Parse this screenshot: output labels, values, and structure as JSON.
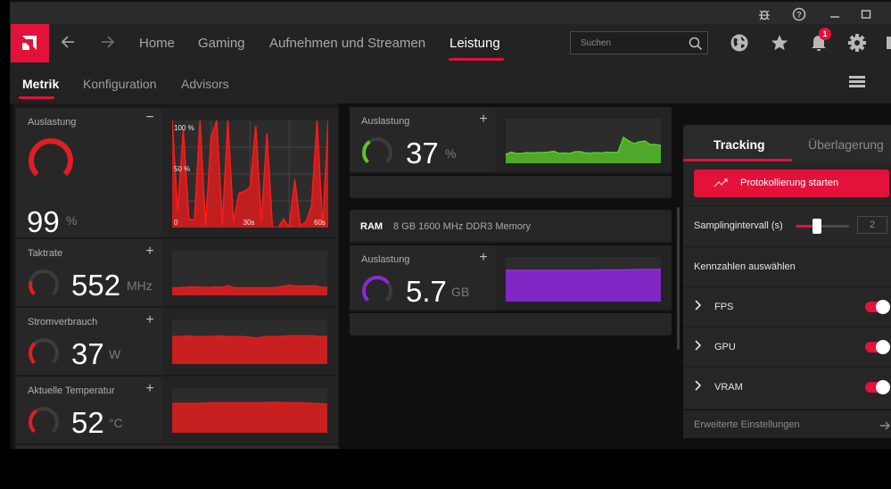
{
  "titlebar": {
    "icons": [
      "bug-report-icon",
      "help-icon",
      "minimize-icon",
      "maximize-icon"
    ]
  },
  "nav": {
    "back_icon": "arrow-left-icon",
    "forward_icon": "arrow-right-icon",
    "links": [
      "Home",
      "Gaming",
      "Aufnehmen und Streamen",
      "Leistung"
    ],
    "active_link": "Leistung",
    "search_placeholder": "Suchen",
    "notification_count": "1",
    "icons": [
      "globe-icon",
      "star-icon",
      "bell-icon",
      "gear-icon"
    ]
  },
  "subtabs": {
    "items": [
      "Metrik",
      "Konfiguration",
      "Advisors"
    ],
    "active": "Metrik"
  },
  "gpu_metrics": [
    {
      "title": "Auslastung",
      "value": "99",
      "unit": "%",
      "action": "−",
      "gauge": 0.99,
      "color": "#e01e24",
      "chart": {
        "y_labels": [
          "100 %",
          "50 %"
        ],
        "x_labels": [
          "0",
          "30s",
          "60s"
        ],
        "values": [
          100,
          15,
          92,
          8,
          7,
          100,
          2,
          85,
          100,
          3,
          100,
          5,
          32,
          34,
          38,
          95,
          5,
          88,
          0,
          0,
          8,
          0,
          45,
          2,
          5,
          20,
          100,
          0,
          100
        ]
      }
    },
    {
      "title": "Taktrate",
      "value": "552",
      "unit": "MHz",
      "action": "+",
      "gauge": 0.22,
      "color": "#e01e24",
      "chart": {
        "values": [
          17,
          17,
          18,
          19,
          19,
          18,
          18,
          19,
          18,
          22,
          17,
          17,
          17,
          17,
          17,
          17,
          17,
          18,
          21,
          23,
          21,
          21,
          21,
          22,
          18,
          18
        ]
      }
    },
    {
      "title": "Stromverbrauch",
      "value": "37",
      "unit": "W",
      "action": "+",
      "gauge": 0.35,
      "color": "#e01e24",
      "chart": {
        "values": [
          37,
          37,
          38,
          37,
          37,
          37,
          38,
          37,
          37,
          37,
          36,
          35,
          37,
          37,
          37,
          38,
          38,
          38,
          38,
          37,
          37
        ]
      }
    },
    {
      "title": "Aktuelle Temperatur",
      "value": "52",
      "unit": "°C",
      "action": "+",
      "gauge": 0.38,
      "color": "#e01e24",
      "chart": {
        "values": [
          46,
          46,
          46,
          47,
          47,
          47,
          47,
          47,
          48,
          47,
          47,
          46,
          45
        ]
      }
    }
  ],
  "cpu_metric": {
    "title": "Auslastung",
    "value": "37",
    "unit": "%",
    "action": "+",
    "gauge": 0.37,
    "color": "#5cc42a",
    "chart": {
      "values": [
        20,
        25,
        22,
        22,
        24,
        23,
        24,
        24,
        25,
        27,
        22,
        23,
        22,
        26,
        26,
        23,
        23,
        24,
        23,
        25,
        24,
        25,
        58,
        50,
        44,
        48,
        50,
        42,
        42,
        40
      ]
    }
  },
  "ram": {
    "label": "RAM",
    "description": "8 GB 1600 MHz DDR3 Memory",
    "metric": {
      "title": "Auslastung",
      "value": "5.7",
      "unit": "GB",
      "action": "+",
      "gauge": 0.7,
      "color": "#8b2ad0",
      "chart": {
        "values": [
          70,
          70,
          70,
          70,
          70,
          70,
          71,
          71,
          72,
          72
        ]
      }
    }
  },
  "right_panel": {
    "tabs": [
      "Tracking",
      "Überlagerung"
    ],
    "active_tab": "Tracking",
    "log_button": "Protokollierung starten",
    "log_icon": "trend-up-icon",
    "sampling_label": "Samplingintervall (s)",
    "sampling_value": "2",
    "sampling_fraction": 0.4,
    "metrics_heading": "Kennzahlen auswählen",
    "metrics": [
      {
        "label": "FPS",
        "enabled": true
      },
      {
        "label": "GPU",
        "enabled": true
      },
      {
        "label": "VRAM",
        "enabled": true
      }
    ],
    "advanced_label": "Erweiterte Einstellungen",
    "advanced_icon": "arrow-right-icon"
  }
}
